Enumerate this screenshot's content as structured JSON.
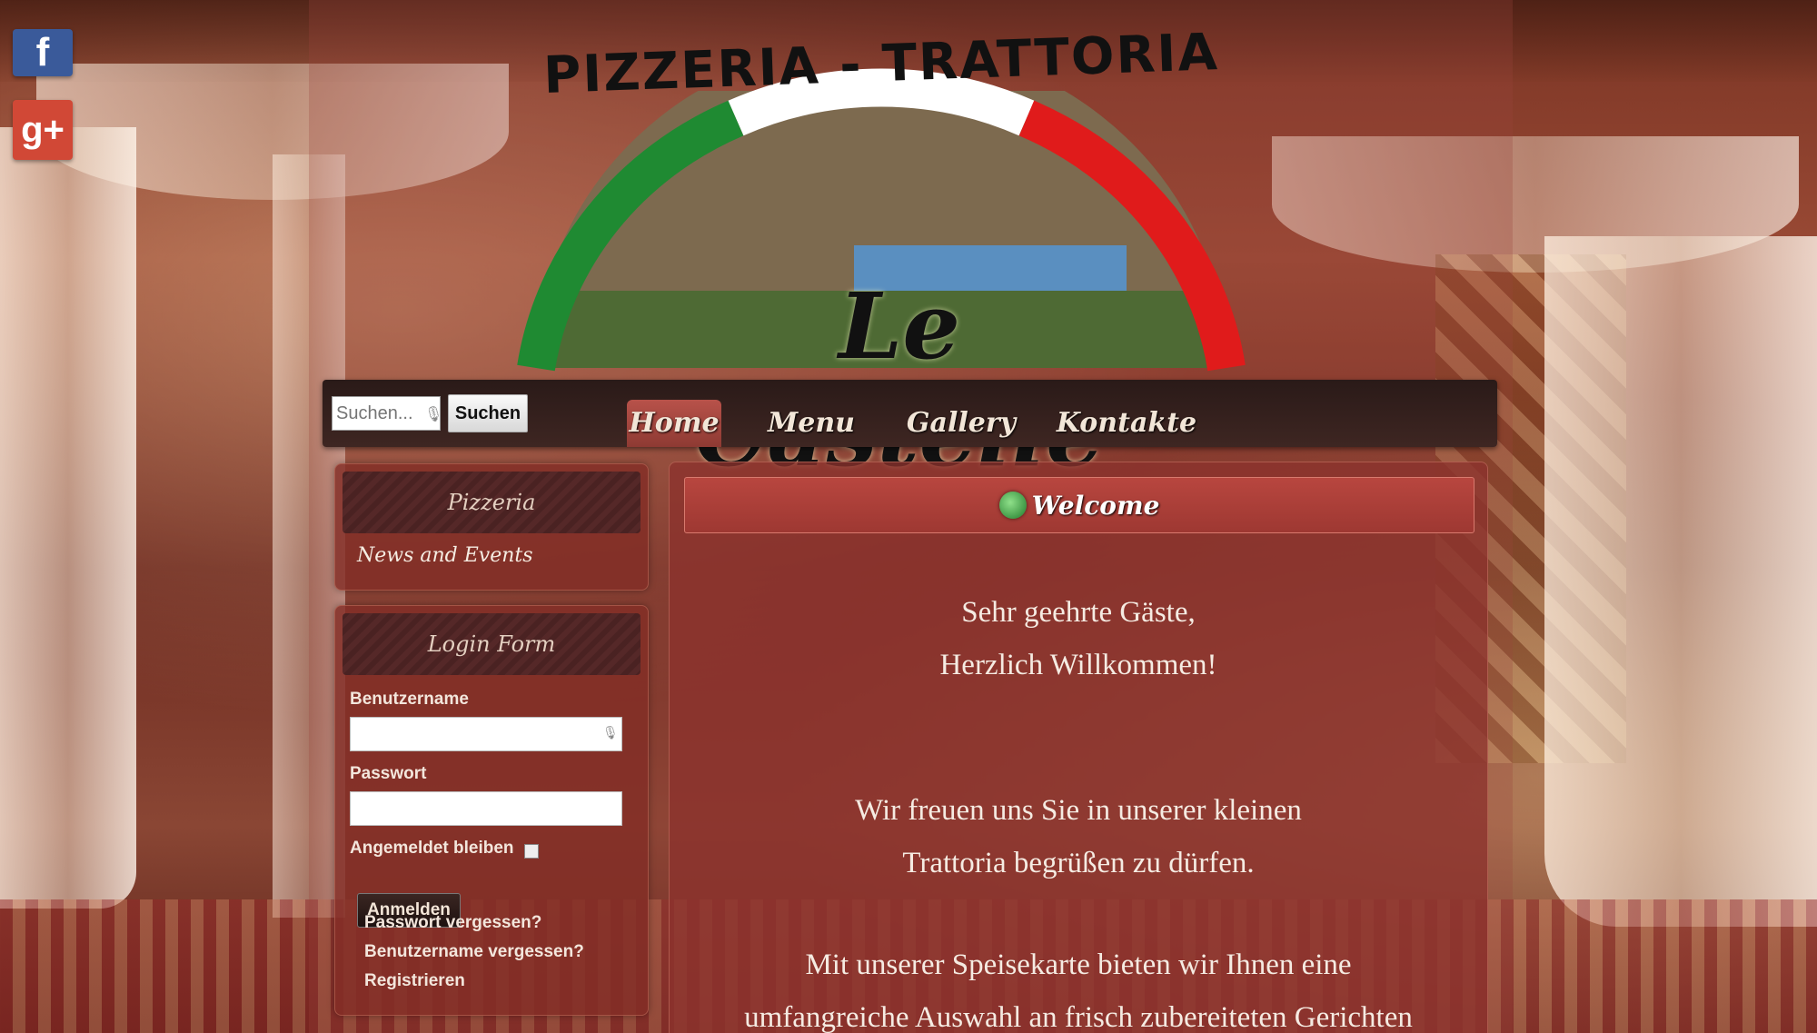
{
  "social": {
    "facebook_glyph": "f",
    "googleplus_glyph": "g+"
  },
  "logo": {
    "title": "PIZZERIA - TRATTORIA",
    "name": "Le Castelle"
  },
  "nav": {
    "search_placeholder": "Suchen...",
    "search_button": "Suchen",
    "tabs": [
      {
        "label": "Home",
        "active": true
      },
      {
        "label": "Menu",
        "active": false
      },
      {
        "label": "Gallery",
        "active": false
      },
      {
        "label": "Kontakte",
        "active": false
      }
    ]
  },
  "sidebar": {
    "pizzeria": {
      "title": "Pizzeria",
      "link": "News and Events"
    },
    "login": {
      "title": "Login Form",
      "username_label": "Benutzername",
      "password_label": "Passwort",
      "remember_label": "Angemeldet bleiben",
      "submit": "Anmelden",
      "forgot_password": "Passwort vergessen?",
      "forgot_username": "Benutzername vergessen?",
      "register": "Registrieren"
    }
  },
  "main": {
    "welcome": "Welcome",
    "lines": [
      "Sehr geehrte Gäste,",
      "Herzlich Willkommen!",
      "Wir freuen uns Sie in unserer kleinen",
      "Trattoria begrüßen zu dürfen.",
      "Mit unserer Speisekarte bieten wir Ihnen eine",
      "umfangreiche Auswahl an frisch zubereiteten Gerichten"
    ]
  },
  "colors": {
    "flag_green": "#1f8a32",
    "flag_white": "#ffffff",
    "flag_red": "#e01b1b",
    "content_bg": "#8c322d",
    "nav_bg": "#2a1a18"
  }
}
